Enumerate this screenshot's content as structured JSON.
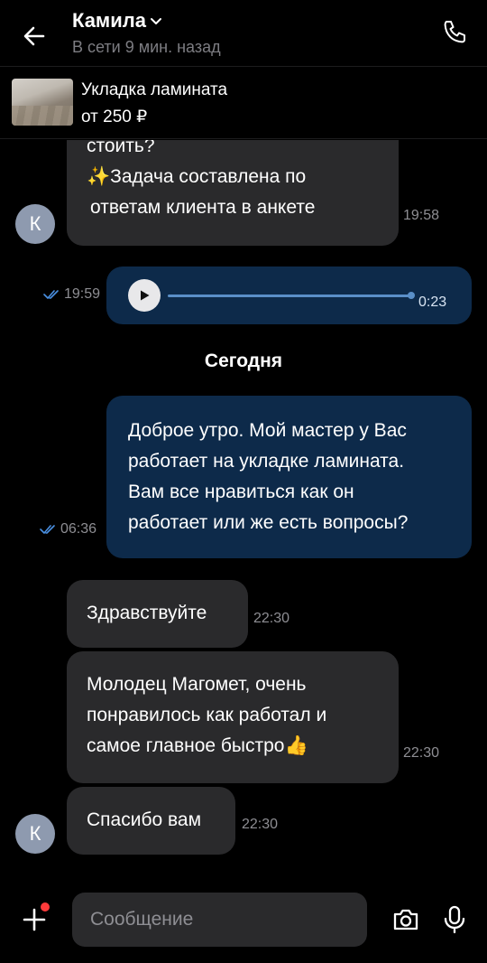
{
  "header": {
    "contact_name": "Камила",
    "status": "В сети 9 мин. назад"
  },
  "listing": {
    "title": "Укладка ламината",
    "price": "от 250 ₽"
  },
  "messages": [
    {
      "direction": "in",
      "lines": [
        "стоить?",
        "✨Задача составлена по",
        "ответам клиента в  анкете"
      ],
      "time": "19:58",
      "avatar": "К"
    },
    {
      "direction": "out",
      "type": "voice",
      "duration": "0:23",
      "time": "19:59",
      "read": true
    },
    {
      "direction": "out",
      "lines": [
        "Доброе утро. Мой мастер у Вас",
        "работает на укладке ламината.",
        "Вам все нравиться как он",
        "работает или же есть вопросы?"
      ],
      "time": "06:36",
      "read": true
    },
    {
      "direction": "in",
      "lines": [
        "Здравствуйте"
      ],
      "time": "22:30"
    },
    {
      "direction": "in",
      "lines": [
        "Молодец Магомет, очень",
        "понравилось как работал и",
        "самое главное быстро👍"
      ],
      "time": "22:30"
    },
    {
      "direction": "in",
      "lines": [
        "Спасибо вам"
      ],
      "time": "22:30",
      "avatar": "К"
    }
  ],
  "date_separator": "Сегодня",
  "input": {
    "placeholder": "Сообщение"
  },
  "colors": {
    "incoming_bubble": "#2a2a2c",
    "outgoing_bubble": "#0d2a4a",
    "read_check": "#4a90e2",
    "notification_dot": "#ff3b3b"
  },
  "icons": [
    "back-arrow-icon",
    "chevron-down-icon",
    "phone-icon",
    "play-icon",
    "double-check-icon",
    "plus-icon",
    "camera-icon",
    "microphone-icon"
  ]
}
